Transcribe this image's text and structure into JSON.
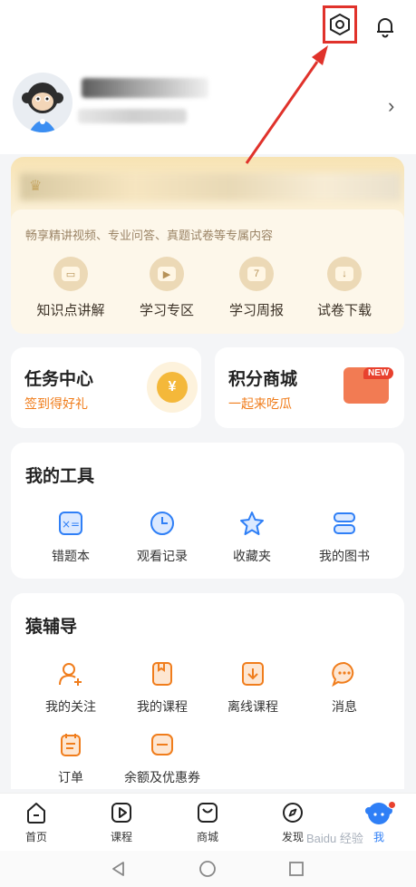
{
  "header": {
    "chevron": "›"
  },
  "vip": {
    "description": "畅享精讲视频、专业问答、真题试卷等专属内容",
    "items": [
      {
        "label": "知识点讲解",
        "icon": "knowledge-icon"
      },
      {
        "label": "学习专区",
        "icon": "play-icon"
      },
      {
        "label": "学习周报",
        "icon": "weekly-report-icon",
        "glyph": "7"
      },
      {
        "label": "试卷下载",
        "icon": "download-icon"
      }
    ]
  },
  "task": {
    "title": "任务中心",
    "subtitle": "签到得好礼",
    "coin": "¥"
  },
  "mall": {
    "title": "积分商城",
    "subtitle": "一起来吃瓜",
    "badge": "NEW"
  },
  "tools": {
    "title": "我的工具",
    "items": [
      {
        "label": "错题本"
      },
      {
        "label": "观看记录"
      },
      {
        "label": "收藏夹"
      },
      {
        "label": "我的图书"
      }
    ]
  },
  "tutor": {
    "title": "猿辅导",
    "items": [
      {
        "label": "我的关注"
      },
      {
        "label": "我的课程"
      },
      {
        "label": "离线课程"
      },
      {
        "label": "消息"
      },
      {
        "label": "订单"
      },
      {
        "label": "余额及优惠券"
      }
    ]
  },
  "tabbar": {
    "tabs": [
      {
        "label": "首页"
      },
      {
        "label": "课程"
      },
      {
        "label": "商城"
      },
      {
        "label": "发现"
      },
      {
        "label": "我"
      }
    ],
    "active_index": 4
  },
  "watermark": "Baidu 经验",
  "colors": {
    "accent": "#2f7ff6",
    "orange": "#f07d1c",
    "annotation": "#e0322b"
  }
}
